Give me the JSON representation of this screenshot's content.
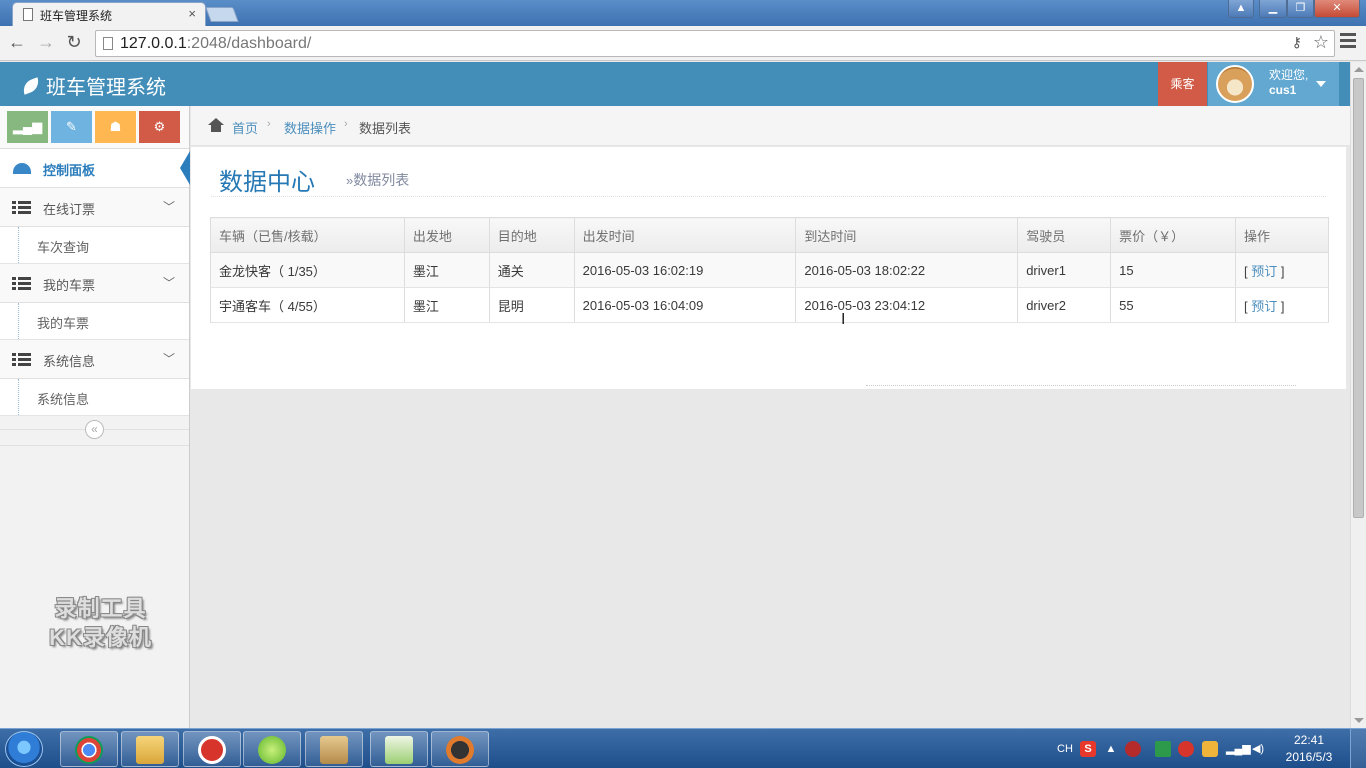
{
  "browser": {
    "tab_title": "班车管理系统",
    "tab_close": "×",
    "url_host": "127.0.0.1",
    "url_rest": ":2048/dashboard/"
  },
  "header": {
    "brand": "班车管理系统",
    "role_badge": "乘客",
    "welcome_line": "欢迎您,",
    "username": "cus1"
  },
  "sidebar": {
    "items": [
      {
        "label": "控制面板"
      },
      {
        "label": "在线订票",
        "sub": "车次查询"
      },
      {
        "label": "我的车票",
        "sub": "我的车票"
      },
      {
        "label": "系统信息",
        "sub": "系统信息"
      }
    ],
    "collapse_symbol": "«"
  },
  "breadcrumbs": [
    "首页",
    "数据操作",
    "数据列表"
  ],
  "page": {
    "title": "数据中心",
    "subtitle": "数据列表"
  },
  "table": {
    "columns": [
      "车辆（已售/核载）",
      "出发地",
      "目的地",
      "出发时间",
      "到达时间",
      "驾驶员",
      "票价（￥）",
      "操作"
    ],
    "rows": [
      {
        "vehicle": "金龙快客（ 1/35）",
        "from": "墨江",
        "to": "通关",
        "depart": "2016-05-03 16:02:19",
        "arrive": "2016-05-03 18:02:22",
        "driver": "driver1",
        "price": "15",
        "action": "预订"
      },
      {
        "vehicle": "宇通客车（ 4/55）",
        "from": "墨江",
        "to": "昆明",
        "depart": "2016-05-03 16:04:09",
        "arrive": "2016-05-03 23:04:12",
        "driver": "driver2",
        "price": "55",
        "action": "预订"
      }
    ]
  },
  "watermark": [
    "录制工具",
    "KK录像机"
  ],
  "taskbar": {
    "lang": "CH",
    "time": "22:41",
    "date": "2016/5/3"
  },
  "colors": {
    "header_bg": "#438eb9",
    "role_badge": "#d15b47",
    "link": "#4c8fbd",
    "title": "#2679b5"
  }
}
